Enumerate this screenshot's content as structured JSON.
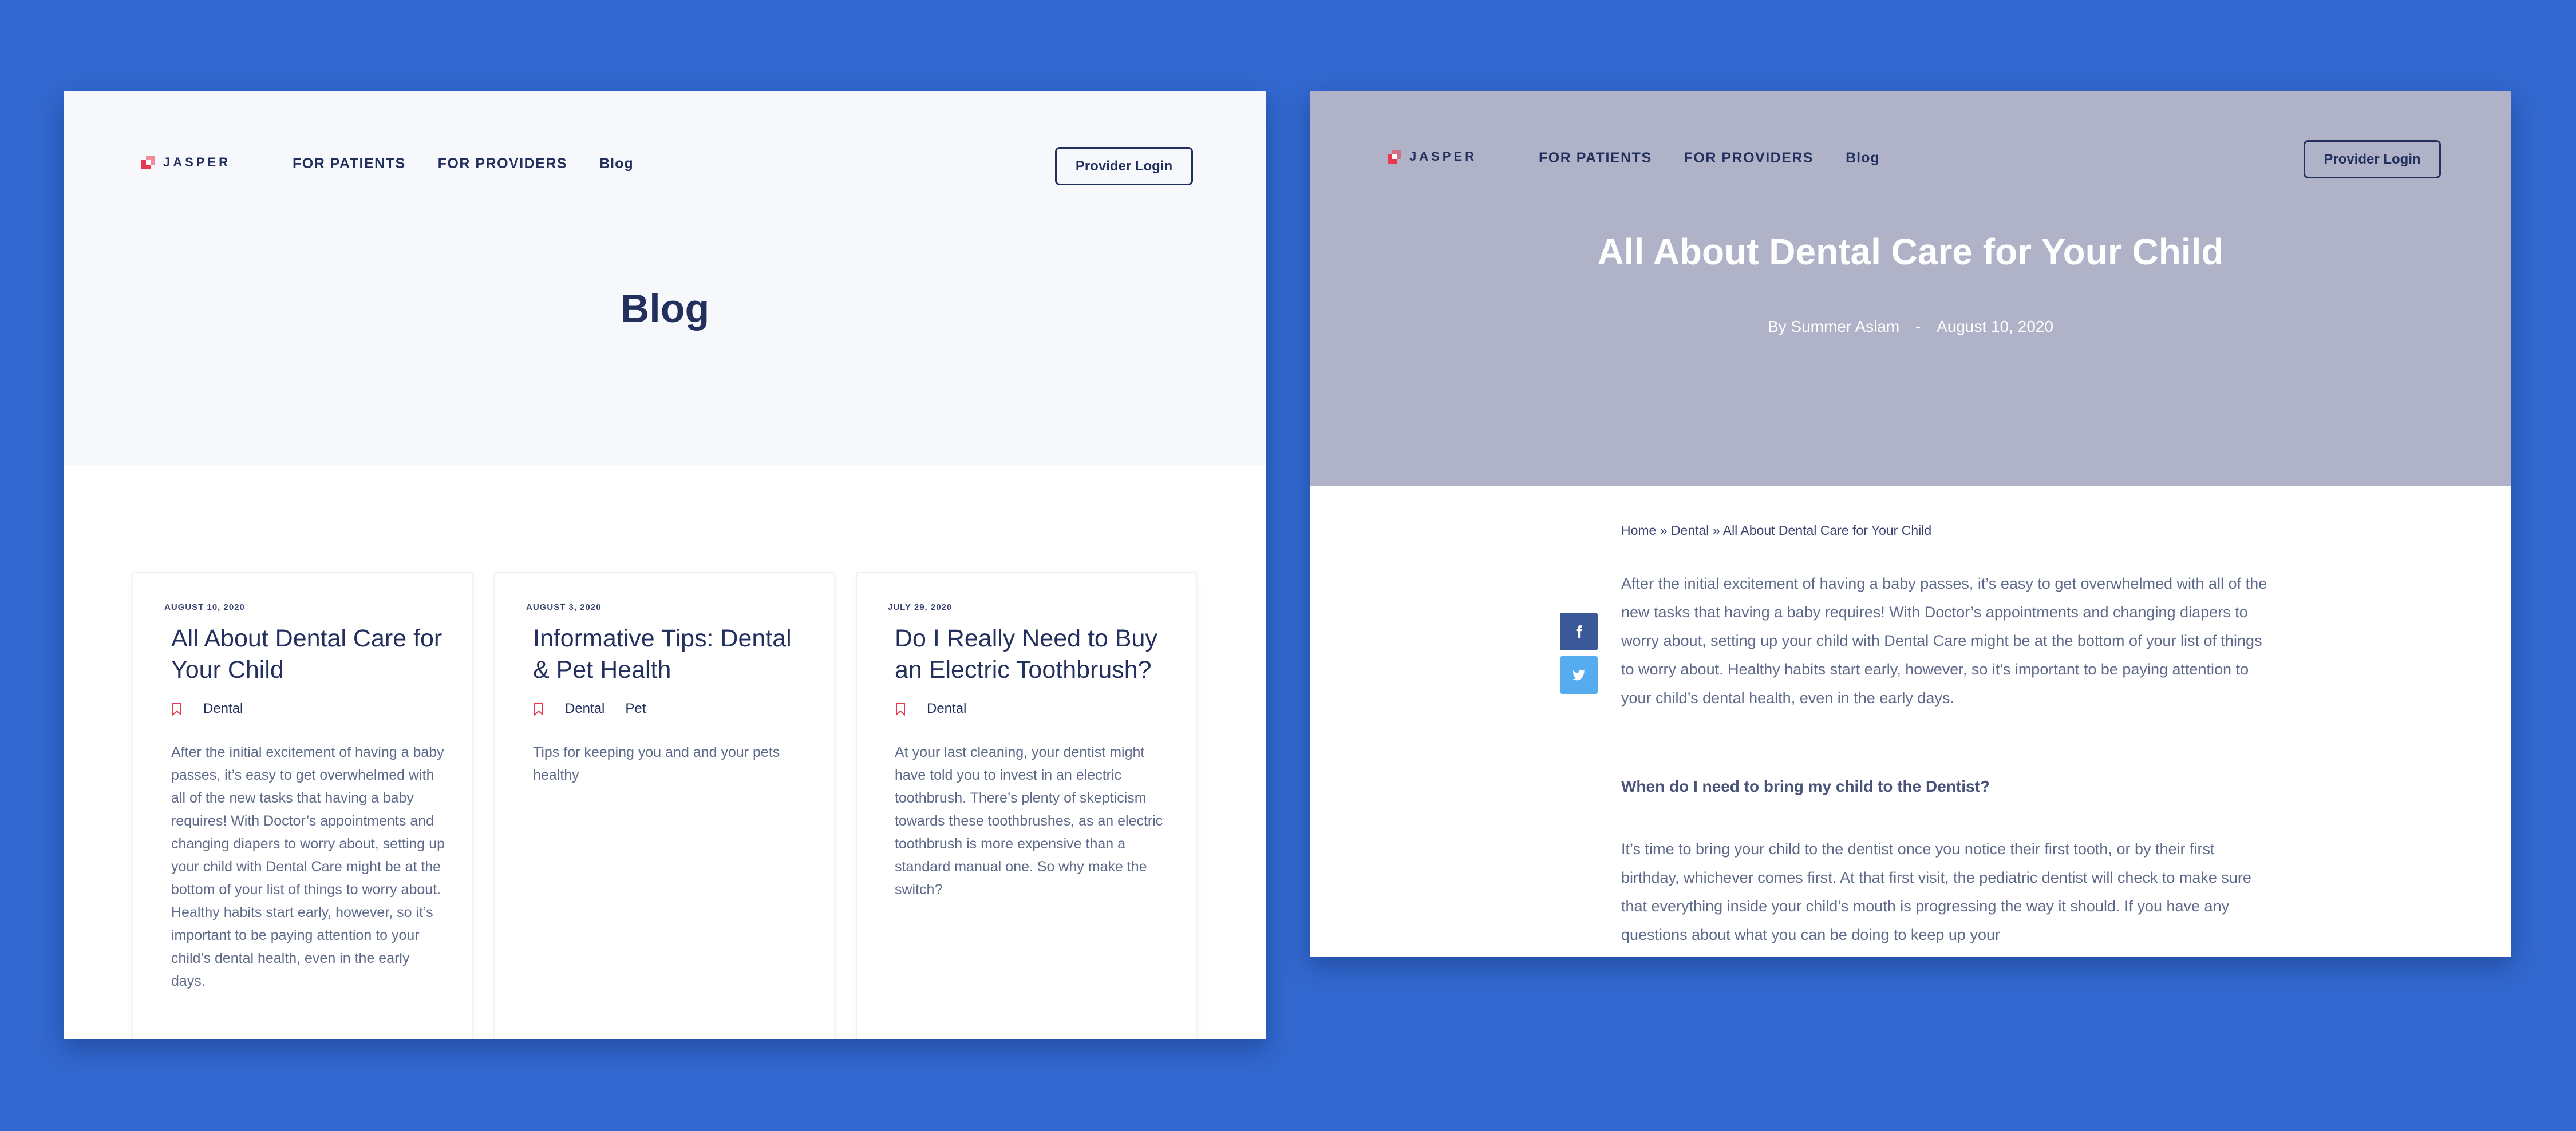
{
  "left": {
    "logo_text": "JASPER",
    "nav": [
      "FOR PATIENTS",
      "FOR PROVIDERS",
      "Blog"
    ],
    "login_label": "Provider Login",
    "page_title": "Blog",
    "cards": [
      {
        "date": "AUGUST 10, 2020",
        "title": "All About Dental Care for Your Child",
        "tags": [
          "Dental"
        ],
        "excerpt": "After the initial excitement of having a baby passes, it’s easy to get overwhelmed with all of the new tasks that having a baby requires! With Doctor’s appointments and changing diapers to worry about, setting up your child with Dental Care might be at the bottom of your list of things to worry about. Healthy habits start early, however, so it’s important to be paying attention to your child’s dental health, even in the early days."
      },
      {
        "date": "AUGUST 3, 2020",
        "title": "Informative Tips: Dental & Pet Health",
        "tags": [
          "Dental",
          "Pet"
        ],
        "excerpt": "Tips for keeping you and and your pets healthy"
      },
      {
        "date": "JULY 29, 2020",
        "title": "Do I Really Need to Buy an Electric Toothbrush?",
        "tags": [
          "Dental"
        ],
        "excerpt": "At your last cleaning, your dentist might have told you to invest in an electric toothbrush. There’s plenty of skepticism towards these toothbrushes, as an electric toothbrush is more expensive than a standard manual one. So why make the switch?"
      }
    ]
  },
  "right": {
    "logo_text": "JASPER",
    "nav": [
      "FOR PATIENTS",
      "FOR PROVIDERS",
      "Blog"
    ],
    "login_label": "Provider Login",
    "post_title": "All About Dental Care for Your Child",
    "author": "By Summer Aslam",
    "meta_sep": "-",
    "date": "August 10, 2020",
    "breadcrumb": {
      "home": "Home",
      "category": "Dental",
      "current": "All About Dental Care for Your Child",
      "sep": "»"
    },
    "share": {
      "facebook_icon": "facebook-icon",
      "twitter_icon": "twitter-icon"
    },
    "paragraph1": "After the initial excitement of having a baby passes, it’s easy to get overwhelmed with all of the new tasks that having a baby requires! With Doctor’s appointments and changing diapers to worry about, setting up your child with Dental Care might be at the bottom of your list of things to worry about. Healthy habits start early, however, so it’s important to be paying attention to your child’s dental health, even in the early days.",
    "heading": "When do I need to bring my child to the Dentist?",
    "paragraph2": "It’s time to bring your child to the dentist once you notice their first tooth, or by their first birthday, whichever comes first. At that first visit, the pediatric dentist will check to make sure that everything inside your child’s mouth is progressing the way it should. If you have any questions about what you can be doing to keep up your"
  },
  "colors": {
    "background": "#3268d0",
    "navy": "#23305e",
    "accent": "#e8374e",
    "hero_gray": "#b0b3c8",
    "facebook": "#3b5998",
    "twitter": "#55acee"
  }
}
